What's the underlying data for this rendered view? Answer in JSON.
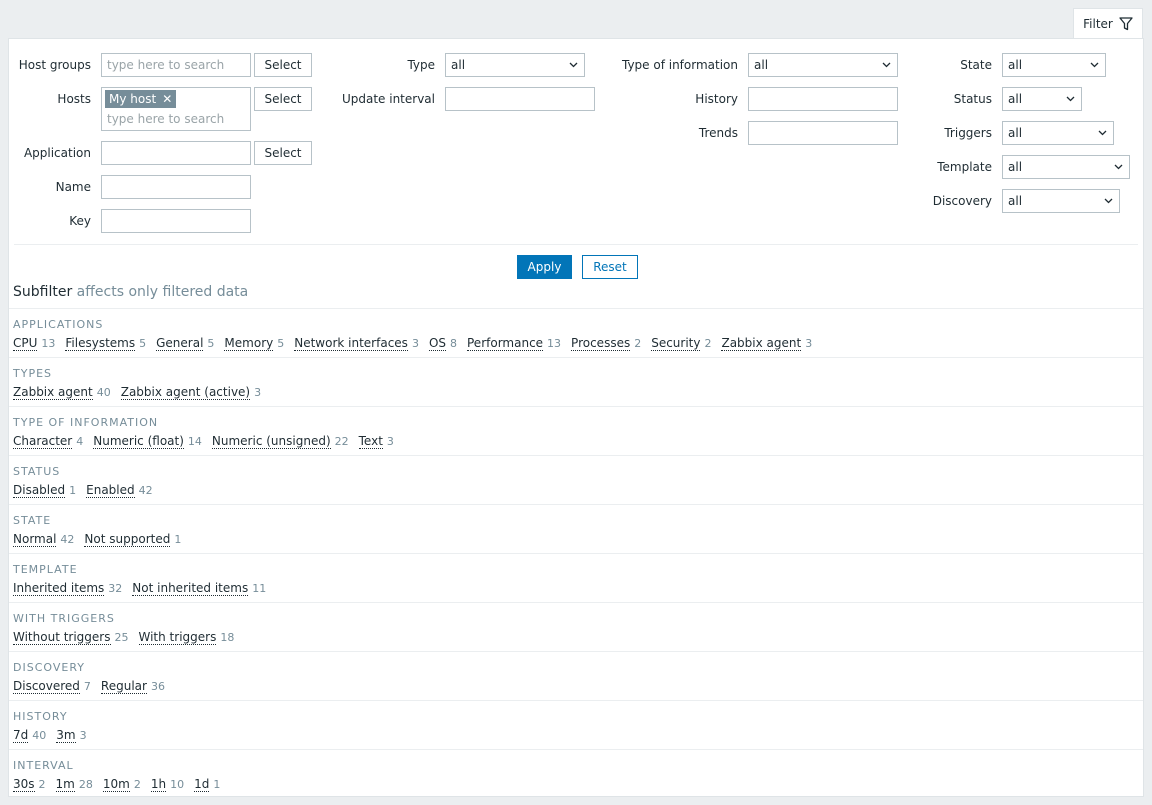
{
  "filter_tab": {
    "label": "Filter"
  },
  "form": {
    "host_groups": {
      "label": "Host groups",
      "placeholder": "type here to search",
      "button": "Select"
    },
    "hosts": {
      "label": "Hosts",
      "chip": "My host",
      "placeholder": "type here to search",
      "button": "Select"
    },
    "application": {
      "label": "Application",
      "value": "",
      "button": "Select"
    },
    "name": {
      "label": "Name",
      "value": ""
    },
    "key": {
      "label": "Key",
      "value": ""
    },
    "type": {
      "label": "Type",
      "value": "all"
    },
    "update_interval": {
      "label": "Update interval",
      "value": ""
    },
    "type_of_information": {
      "label": "Type of information",
      "value": "all"
    },
    "history": {
      "label": "History",
      "value": ""
    },
    "trends": {
      "label": "Trends",
      "value": ""
    },
    "state": {
      "label": "State",
      "value": "all"
    },
    "status": {
      "label": "Status",
      "value": "all"
    },
    "triggers": {
      "label": "Triggers",
      "value": "all"
    },
    "template": {
      "label": "Template",
      "value": "all"
    },
    "discovery": {
      "label": "Discovery",
      "value": "all"
    }
  },
  "buttons": {
    "apply": "Apply",
    "reset": "Reset"
  },
  "subfilter": {
    "title": "Subfilter",
    "note": "affects only filtered data",
    "sections": [
      {
        "title": "APPLICATIONS",
        "items": [
          {
            "name": "CPU",
            "count": "13"
          },
          {
            "name": "Filesystems",
            "count": "5"
          },
          {
            "name": "General",
            "count": "5"
          },
          {
            "name": "Memory",
            "count": "5"
          },
          {
            "name": "Network interfaces",
            "count": "3"
          },
          {
            "name": "OS",
            "count": "8"
          },
          {
            "name": "Performance",
            "count": "13"
          },
          {
            "name": "Processes",
            "count": "2"
          },
          {
            "name": "Security",
            "count": "2"
          },
          {
            "name": "Zabbix agent",
            "count": "3"
          }
        ]
      },
      {
        "title": "TYPES",
        "items": [
          {
            "name": "Zabbix agent",
            "count": "40"
          },
          {
            "name": "Zabbix agent (active)",
            "count": "3"
          }
        ]
      },
      {
        "title": "TYPE OF INFORMATION",
        "items": [
          {
            "name": "Character",
            "count": "4"
          },
          {
            "name": "Numeric (float)",
            "count": "14"
          },
          {
            "name": "Numeric (unsigned)",
            "count": "22"
          },
          {
            "name": "Text",
            "count": "3"
          }
        ]
      },
      {
        "title": "STATUS",
        "items": [
          {
            "name": "Disabled",
            "count": "1"
          },
          {
            "name": "Enabled",
            "count": "42"
          }
        ]
      },
      {
        "title": "STATE",
        "items": [
          {
            "name": "Normal",
            "count": "42"
          },
          {
            "name": "Not supported",
            "count": "1"
          }
        ]
      },
      {
        "title": "TEMPLATE",
        "items": [
          {
            "name": "Inherited items",
            "count": "32"
          },
          {
            "name": "Not inherited items",
            "count": "11"
          }
        ]
      },
      {
        "title": "WITH TRIGGERS",
        "items": [
          {
            "name": "Without triggers",
            "count": "25"
          },
          {
            "name": "With triggers",
            "count": "18"
          }
        ]
      },
      {
        "title": "DISCOVERY",
        "items": [
          {
            "name": "Discovered",
            "count": "7"
          },
          {
            "name": "Regular",
            "count": "36"
          }
        ]
      },
      {
        "title": "HISTORY",
        "items": [
          {
            "name": "7d",
            "count": "40"
          },
          {
            "name": "3m",
            "count": "3"
          }
        ]
      },
      {
        "title": "INTERVAL",
        "items": [
          {
            "name": "30s",
            "count": "2"
          },
          {
            "name": "1m",
            "count": "28"
          },
          {
            "name": "10m",
            "count": "2"
          },
          {
            "name": "1h",
            "count": "10"
          },
          {
            "name": "1d",
            "count": "1"
          }
        ]
      }
    ]
  }
}
